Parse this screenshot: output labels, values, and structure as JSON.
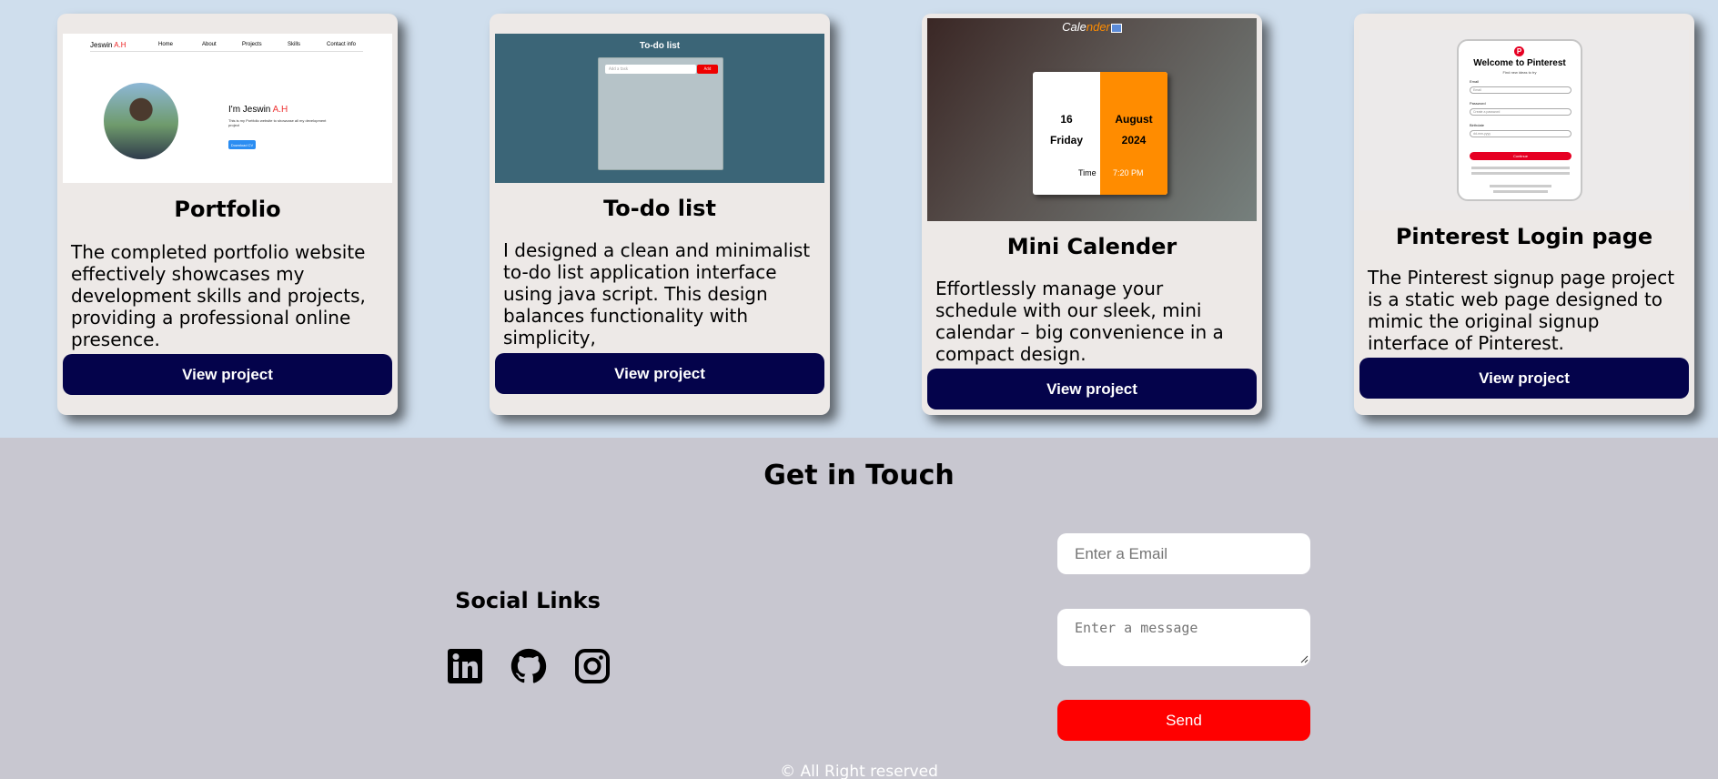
{
  "projects": [
    {
      "title": "Portfolio",
      "description": "The completed portfolio website effectively showcases my development skills and projects, providing a professional online presence.",
      "button": "View project",
      "preview": {
        "brand": "Jeswin ",
        "brand_accent": "A.H",
        "nav": [
          "Home",
          "About",
          "Projects",
          "Skills",
          "Contact info"
        ],
        "greeting": "I'm Jeswin ",
        "greeting_accent": "A.H",
        "blurb": "This is my Portfolio website to showcase all my development project",
        "download": "Download CV"
      }
    },
    {
      "title": "To-do list",
      "description": "I designed a clean and minimalist to-do list application interface using java script. This design balances functionality with simplicity,",
      "button": "View project",
      "preview": {
        "heading": "To-do list",
        "input_placeholder": "Add a task",
        "add_label": "Add"
      }
    },
    {
      "title": "Mini Calender",
      "description": "Effortlessly manage your schedule with our sleek, mini calendar – big convenience in a compact design.",
      "button": "View project",
      "preview": {
        "heading": "Cale",
        "heading_accent": "nder",
        "day_num": "16",
        "day_name": "Friday",
        "month": "August",
        "year": "2024",
        "time_label": "Time",
        "time_value": "7:20 PM"
      }
    },
    {
      "title": "Pinterest Login page",
      "description": "The Pinterest signup page project is a static web page designed to mimic the original signup interface of Pinterest.",
      "button": "View project",
      "preview": {
        "logo": "P",
        "heading": "Welcome to Pinterest",
        "subheading": "Find new ideas to try",
        "email_label": "Email",
        "email_placeholder": "Email",
        "password_label": "Password",
        "password_placeholder": "Create a password",
        "birthdate_label": "Birthdate",
        "birthdate_value": "dd-mm-yyyy",
        "continue": "Continue"
      }
    }
  ],
  "contact": {
    "heading": "Get in Touch",
    "social_title": "Social Links",
    "social": [
      "linkedin-icon",
      "github-icon",
      "instagram-icon"
    ],
    "email_placeholder": "Enter a Email",
    "message_placeholder": "Enter a message",
    "send": "Send",
    "copyright": "© All Right reserved"
  },
  "colors": {
    "projects_bg": "#cfdeed",
    "contact_bg": "#c8c7d0",
    "card_bg": "#ede9e7",
    "button_navy": "#04034b",
    "send_red": "#ff0000"
  }
}
